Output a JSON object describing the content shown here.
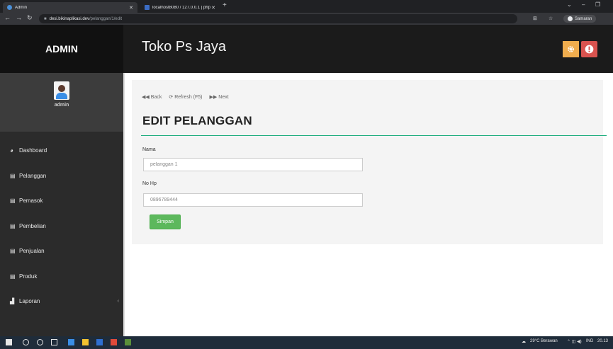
{
  "browser": {
    "tabs": [
      {
        "title": "Admin",
        "active": true
      },
      {
        "title": "localhost8080 / 127.0.0.1 | php",
        "active": false
      }
    ],
    "url_host": "desi.bikinaplikasi.dev",
    "url_path": "/pelanggan/1/edit",
    "profile_label": "Samaran"
  },
  "header": {
    "brand": "ADMIN",
    "store_title": "Toko Ps Jaya"
  },
  "sidebar": {
    "username": "admin",
    "items": [
      {
        "label": "Dashboard",
        "icon": "dashboard-icon"
      },
      {
        "label": "Pelanggan",
        "icon": "table-icon"
      },
      {
        "label": "Pemasok",
        "icon": "table-icon"
      },
      {
        "label": "Pembelian",
        "icon": "table-icon"
      },
      {
        "label": "Penjualan",
        "icon": "table-icon"
      },
      {
        "label": "Produk",
        "icon": "table-icon"
      },
      {
        "label": "Laporan",
        "icon": "bar-chart-icon"
      }
    ]
  },
  "toolbar": {
    "back_label": "Back",
    "refresh_label": "Refresh (F5)",
    "next_label": "Next"
  },
  "form": {
    "heading": "EDIT PELANGGAN",
    "nama_label": "Nama",
    "nama_value": "pelanggan 1",
    "nohp_label": "No Hp",
    "nohp_value": "0896789444",
    "save_label": "Simpan"
  },
  "taskbar": {
    "weather": "29°C Berawan",
    "language": "IND",
    "time": "20.13"
  },
  "colors": {
    "accent_green": "#1fae7e",
    "save_button": "#5cb85c",
    "settings_button": "#f0ad4e",
    "logout_button": "#d9534f"
  }
}
